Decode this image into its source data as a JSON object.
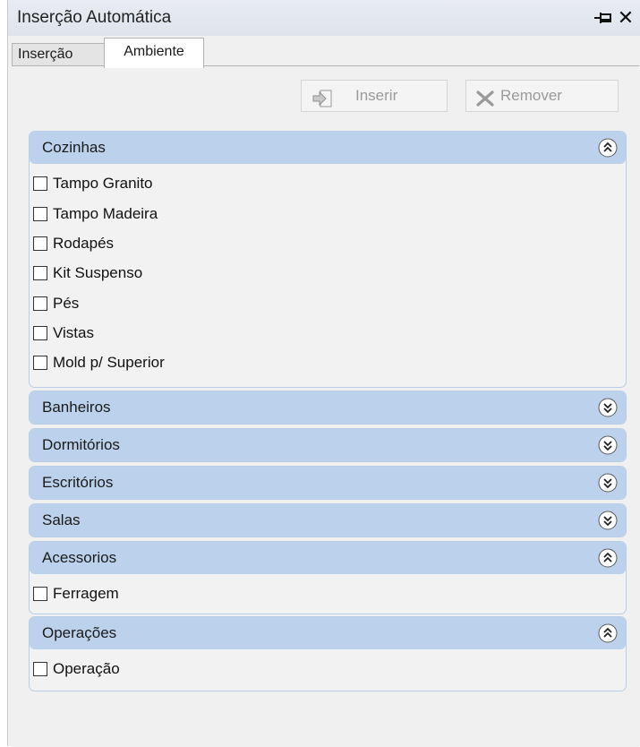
{
  "window": {
    "title": "Inserção Automática"
  },
  "tabs": [
    {
      "label": "Inserção",
      "active": false
    },
    {
      "label": "Ambiente",
      "active": true
    }
  ],
  "toolbar": {
    "insert_label": "Inserir",
    "remove_label": "Remover",
    "insert_enabled": false,
    "remove_enabled": false
  },
  "groups": [
    {
      "title": "Cozinhas",
      "expanded": true,
      "items": [
        "Tampo Granito",
        "Tampo Madeira",
        "Rodapés",
        "Kit Suspenso",
        "Pés",
        "Vistas",
        "Mold p/ Superior"
      ]
    },
    {
      "title": "Banheiros",
      "expanded": false,
      "items": []
    },
    {
      "title": "Dormitórios",
      "expanded": false,
      "items": []
    },
    {
      "title": "Escritórios",
      "expanded": false,
      "items": []
    },
    {
      "title": "Salas",
      "expanded": false,
      "items": []
    },
    {
      "title": "Acessorios",
      "expanded": true,
      "items": [
        "Ferragem"
      ]
    },
    {
      "title": "Operações",
      "expanded": true,
      "items": [
        "Operação"
      ]
    }
  ],
  "colors": {
    "group_header": "#bcd2ec",
    "group_border": "#b9cde6",
    "background": "#f0f0f0",
    "disabled_text": "#9a9a9a"
  },
  "icons": {
    "pin": "pin-icon",
    "close": "close-icon",
    "insert": "insert-arrow-icon",
    "remove": "x-icon",
    "collapse": "chevron-double-up-icon",
    "expand": "chevron-double-down-icon"
  }
}
